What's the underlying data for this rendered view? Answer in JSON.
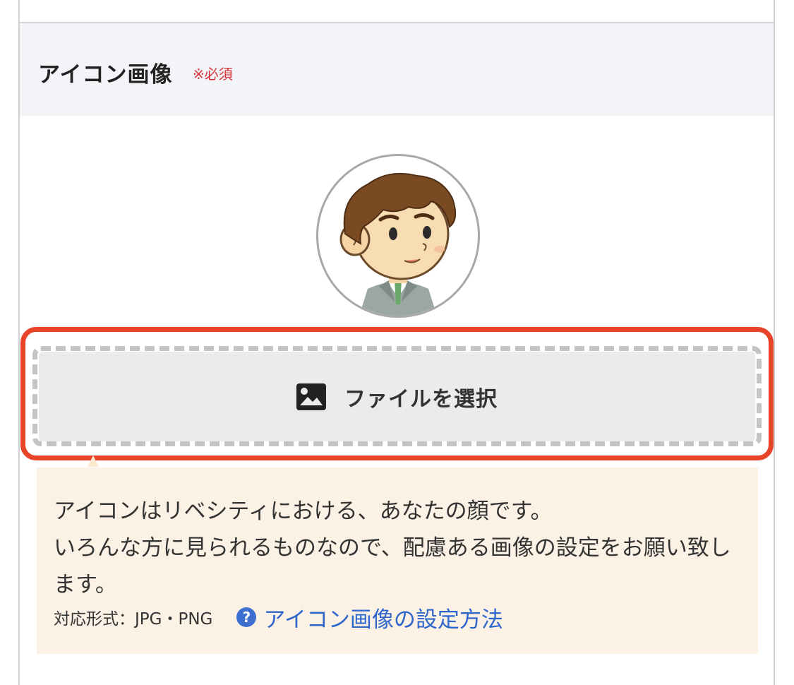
{
  "field": {
    "title": "アイコン画像",
    "required": "※必須"
  },
  "avatar": {
    "description": "avatar-man-in-suit"
  },
  "file_button": {
    "icon": "image-icon",
    "label": "ファイルを選択"
  },
  "notice": {
    "line1": "アイコンはリベシティにおける、あなたの顔です。",
    "line2": "いろんな方に見られるものなので、配慮ある画像の設定をお願い致します。",
    "formats": "対応形式：JPG・PNG",
    "help_icon": "?",
    "help_link": "アイコン画像の設定方法"
  },
  "colors": {
    "required": "#d6343a",
    "highlight": "#e8442a",
    "link": "#2f66cb",
    "notice_bg": "#fbf2e5",
    "header_bg": "#f3f4f8"
  }
}
